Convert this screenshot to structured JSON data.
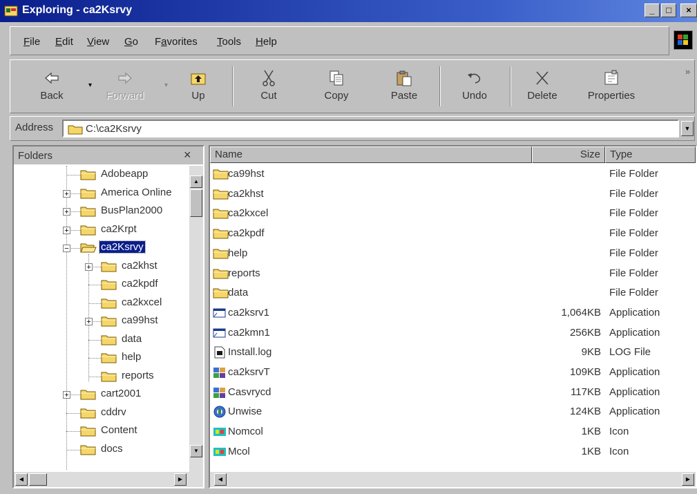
{
  "window": {
    "title": "Exploring - ca2Ksrvy"
  },
  "menu": [
    {
      "label": "File",
      "ul": "F",
      "rest": "ile"
    },
    {
      "label": "Edit",
      "ul": "E",
      "rest": "dit"
    },
    {
      "label": "View",
      "ul": "V",
      "rest": "iew"
    },
    {
      "label": "Go",
      "ul": "G",
      "rest": "o"
    },
    {
      "label": "Favorites",
      "pre": "F",
      "ul": "a",
      "rest": "vorites"
    },
    {
      "label": "Tools",
      "ul": "T",
      "rest": "ools"
    },
    {
      "label": "Help",
      "ul": "H",
      "rest": "elp"
    }
  ],
  "toolbar": {
    "back": "Back",
    "forward": "Forward",
    "up": "Up",
    "cut": "Cut",
    "copy": "Copy",
    "paste": "Paste",
    "undo": "Undo",
    "delete": "Delete",
    "properties": "Properties",
    "overflow": "»"
  },
  "address": {
    "label": "Address",
    "value": "C:\\ca2Ksrvy"
  },
  "folders": {
    "title": "Folders",
    "close": "×",
    "tree": [
      {
        "label": "Adobeapp",
        "expander": ""
      },
      {
        "label": "America Online",
        "expander": "+"
      },
      {
        "label": "BusPlan2000",
        "expander": "+"
      },
      {
        "label": "ca2Krpt",
        "expander": "+"
      },
      {
        "label": "ca2Ksrvy",
        "expander": "-",
        "selected": true
      },
      {
        "label": "ca2khst",
        "expander": "+"
      },
      {
        "label": "ca2kpdf",
        "expander": ""
      },
      {
        "label": "ca2kxcel",
        "expander": ""
      },
      {
        "label": "ca99hst",
        "expander": "+"
      },
      {
        "label": "data",
        "expander": ""
      },
      {
        "label": "help",
        "expander": ""
      },
      {
        "label": "reports",
        "expander": ""
      },
      {
        "label": "cart2001",
        "expander": "+"
      },
      {
        "label": "cddrv",
        "expander": ""
      },
      {
        "label": "Content",
        "expander": ""
      },
      {
        "label": "docs",
        "expander": ""
      }
    ]
  },
  "files": {
    "columns": {
      "name": "Name",
      "size": "Size",
      "type": "Type"
    },
    "rows": [
      {
        "name": "ca99hst",
        "size": "",
        "type": "File Folder",
        "icon": "folder-icon"
      },
      {
        "name": "ca2khst",
        "size": "",
        "type": "File Folder",
        "icon": "folder-icon"
      },
      {
        "name": "ca2kxcel",
        "size": "",
        "type": "File Folder",
        "icon": "folder-icon"
      },
      {
        "name": "ca2kpdf",
        "size": "",
        "type": "File Folder",
        "icon": "folder-icon"
      },
      {
        "name": "help",
        "size": "",
        "type": "File Folder",
        "icon": "folder-icon"
      },
      {
        "name": "reports",
        "size": "",
        "type": "File Folder",
        "icon": "folder-icon"
      },
      {
        "name": "data",
        "size": "",
        "type": "File Folder",
        "icon": "folder-icon"
      },
      {
        "name": "ca2ksrv1",
        "size": "1,064KB",
        "type": "Application",
        "icon": "application-icon"
      },
      {
        "name": "ca2kmn1",
        "size": "256KB",
        "type": "Application",
        "icon": "application-icon"
      },
      {
        "name": "Install.log",
        "size": "9KB",
        "type": "LOG File",
        "icon": "log-file-icon"
      },
      {
        "name": "ca2ksrvT",
        "size": "109KB",
        "type": "Application",
        "icon": "setup-app-icon"
      },
      {
        "name": "Casvrycd",
        "size": "117KB",
        "type": "Application",
        "icon": "setup-app-icon"
      },
      {
        "name": "Unwise",
        "size": "124KB",
        "type": "Application",
        "icon": "uninstall-app-icon"
      },
      {
        "name": "Nomcol",
        "size": "1KB",
        "type": "Icon",
        "icon": "icon-file-icon"
      },
      {
        "name": "Mcol",
        "size": "1KB",
        "type": "Icon",
        "icon": "icon-file-icon"
      }
    ]
  },
  "colors": {
    "titlebar": "#0a1e8c",
    "chrome": "#c0c0c0",
    "folder": "#f5d66a",
    "selection": "#0a1e8c"
  }
}
